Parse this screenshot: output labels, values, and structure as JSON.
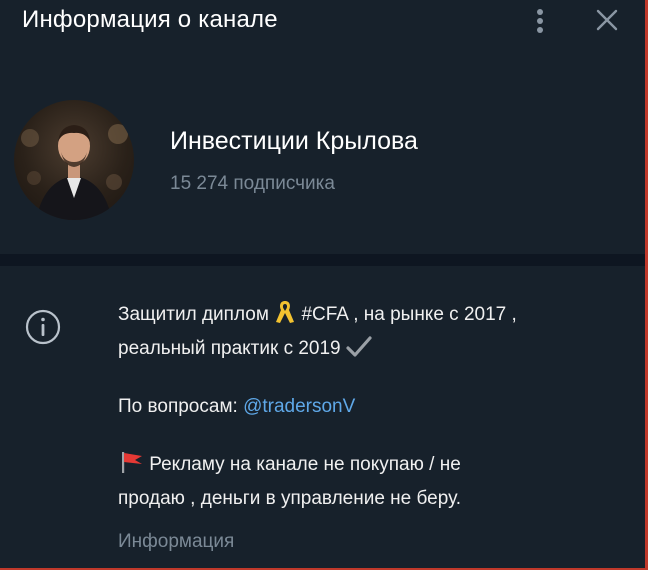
{
  "header": {
    "title": "Информация о канале",
    "menu_icon": "kebab-icon",
    "close_icon": "close-icon"
  },
  "channel": {
    "name": "Инвестиции Крылова",
    "subscribers": "15 274 подписчика"
  },
  "description": {
    "line1_pre": "Защитил диплом ",
    "line1_post": " #CFA , на рынке с 2017 ,",
    "line2": "реальный практик с 2019 ",
    "contact_label": "По вопросам: ",
    "contact_handle": "@tradersonV",
    "ads_text_line1": " Рекламу на канале не покупаю / не",
    "ads_text_line2": "продаю , деньги в управление не беру."
  },
  "info_label": "Информация",
  "colors": {
    "background": "#17212b",
    "link": "#5fa8e8",
    "muted": "#7b8996"
  }
}
